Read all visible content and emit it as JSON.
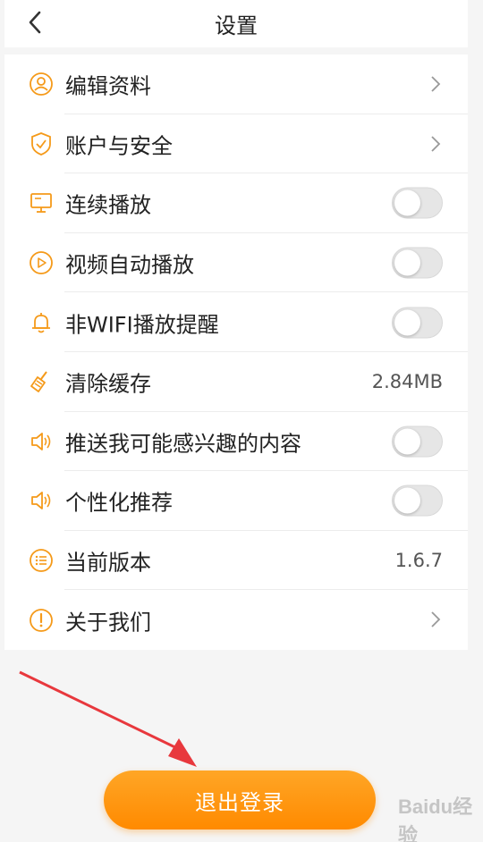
{
  "header": {
    "title": "设置"
  },
  "settings": [
    {
      "label": "编辑资料",
      "icon": "user-icon",
      "control": "chevron"
    },
    {
      "label": "账户与安全",
      "icon": "shield-icon",
      "control": "chevron"
    },
    {
      "label": "连续播放",
      "icon": "monitor-icon",
      "control": "toggle",
      "on": false
    },
    {
      "label": "视频自动播放",
      "icon": "play-circle-icon",
      "control": "toggle",
      "on": false
    },
    {
      "label": "非WIFI播放提醒",
      "icon": "bell-icon",
      "control": "toggle",
      "on": false
    },
    {
      "label": "清除缓存",
      "icon": "broom-icon",
      "control": "value",
      "value": "2.84MB"
    },
    {
      "label": "推送我可能感兴趣的内容",
      "icon": "speaker-icon",
      "control": "toggle",
      "on": false
    },
    {
      "label": "个性化推荐",
      "icon": "speaker-icon",
      "control": "toggle",
      "on": false
    },
    {
      "label": "当前版本",
      "icon": "list-circle-icon",
      "control": "value",
      "value": "1.6.7"
    },
    {
      "label": "关于我们",
      "icon": "info-circle-icon",
      "control": "chevron"
    }
  ],
  "logout": {
    "label": "退出登录"
  },
  "colors": {
    "accent": "#ff9500",
    "icon": "#f59a1a",
    "annotation_arrow": "#e8383d"
  },
  "watermark": {
    "text": "Baidu经验"
  }
}
